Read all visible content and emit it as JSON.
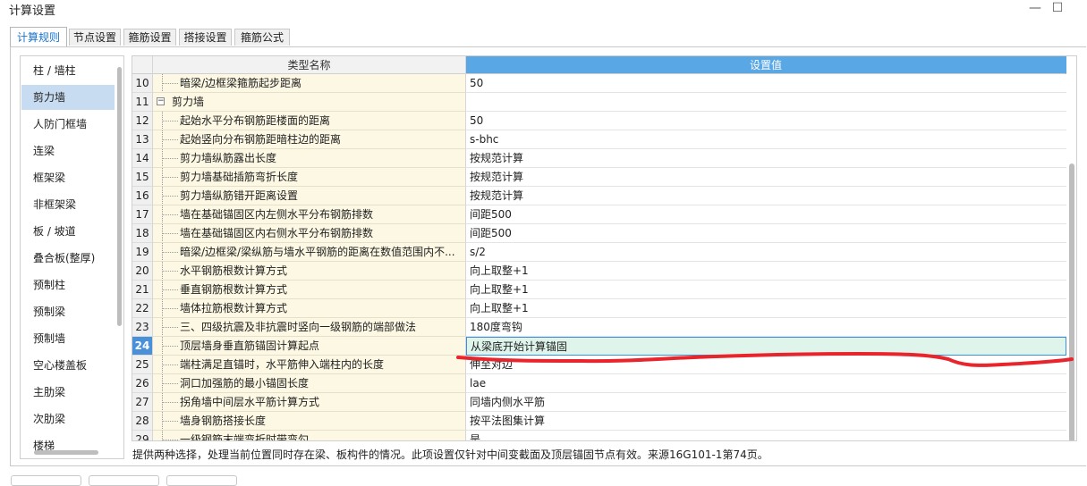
{
  "window": {
    "title": "计算设置",
    "minimize_icon": "minimize-icon",
    "maximize_icon": "maximize-icon",
    "minimize_glyph": "—",
    "maximize_glyph": "☐"
  },
  "tabs": [
    {
      "label": "计算规则",
      "active": true
    },
    {
      "label": "节点设置",
      "active": false
    },
    {
      "label": "箍筋设置",
      "active": false
    },
    {
      "label": "搭接设置",
      "active": false
    },
    {
      "label": "箍筋公式",
      "active": false
    }
  ],
  "sidebar": {
    "selected": "剪力墙",
    "items": [
      "柱 / 墙柱",
      "剪力墙",
      "人防门框墙",
      "连梁",
      "框架梁",
      "非框架梁",
      "板 / 坡道",
      "叠合板(整厚)",
      "预制柱",
      "预制梁",
      "预制墙",
      "空心楼盖板",
      "主肋梁",
      "次肋梁",
      "楼梯"
    ]
  },
  "table": {
    "headers": {
      "name": "类型名称",
      "value": "设置值"
    },
    "selected_row": "24",
    "rows": [
      {
        "num": "10",
        "name": "暗梁/边框梁箍筋起步距离",
        "value": "50"
      },
      {
        "num": "11",
        "name": "剪力墙",
        "value": "",
        "group": true,
        "expander": "−"
      },
      {
        "num": "12",
        "name": "起始水平分布钢筋距楼面的距离",
        "value": "50"
      },
      {
        "num": "13",
        "name": "起始竖向分布钢筋距暗柱边的距离",
        "value": "s-bhc"
      },
      {
        "num": "14",
        "name": "剪力墙纵筋露出长度",
        "value": "按规范计算"
      },
      {
        "num": "15",
        "name": "剪力墙基础插筋弯折长度",
        "value": "按规范计算"
      },
      {
        "num": "16",
        "name": "剪力墙纵筋错开距离设置",
        "value": "按规范计算"
      },
      {
        "num": "17",
        "name": "墙在基础锚固区内左侧水平分布钢筋排数",
        "value": "间距500"
      },
      {
        "num": "18",
        "name": "墙在基础锚固区内右侧水平分布钢筋排数",
        "value": "间距500"
      },
      {
        "num": "19",
        "name": "暗梁/边框梁/梁纵筋与墙水平钢筋的距离在数值范围内不...",
        "value": "s/2"
      },
      {
        "num": "20",
        "name": "水平钢筋根数计算方式",
        "value": "向上取整+1"
      },
      {
        "num": "21",
        "name": "垂直钢筋根数计算方式",
        "value": "向上取整+1"
      },
      {
        "num": "22",
        "name": "墙体拉筋根数计算方式",
        "value": "向上取整+1"
      },
      {
        "num": "23",
        "name": "三、四级抗震及非抗震时竖向一级钢筋的端部做法",
        "value": "180度弯钩"
      },
      {
        "num": "24",
        "name": "顶层墙身垂直筋锚固计算起点",
        "value": "从梁底开始计算锚固"
      },
      {
        "num": "25",
        "name": "端柱满足直锚时，水平筋伸入端柱内的长度",
        "value": "伸至对边"
      },
      {
        "num": "26",
        "name": "洞口加强筋的最小锚固长度",
        "value": "lae"
      },
      {
        "num": "27",
        "name": "拐角墙中间层水平筋计算方式",
        "value": "同墙内侧水平筋"
      },
      {
        "num": "28",
        "name": "墙身钢筋搭接长度",
        "value": "按平法图集计算"
      },
      {
        "num": "29",
        "name": "一级钢筋末端弯折时带弯勾",
        "value": "是"
      }
    ]
  },
  "description": "提供两种选择，处理当前位置同时存在梁、板构件的情况。此项设置仅针对中间变截面及顶层锚固节点有效。来源16G101-1第74页。",
  "annotation": {
    "color": "#e8242c"
  },
  "colors": {
    "accent": "#5aa7e6",
    "selected_row_bg": "#dff5ec",
    "name_col_bg": "#fdf8e3"
  }
}
